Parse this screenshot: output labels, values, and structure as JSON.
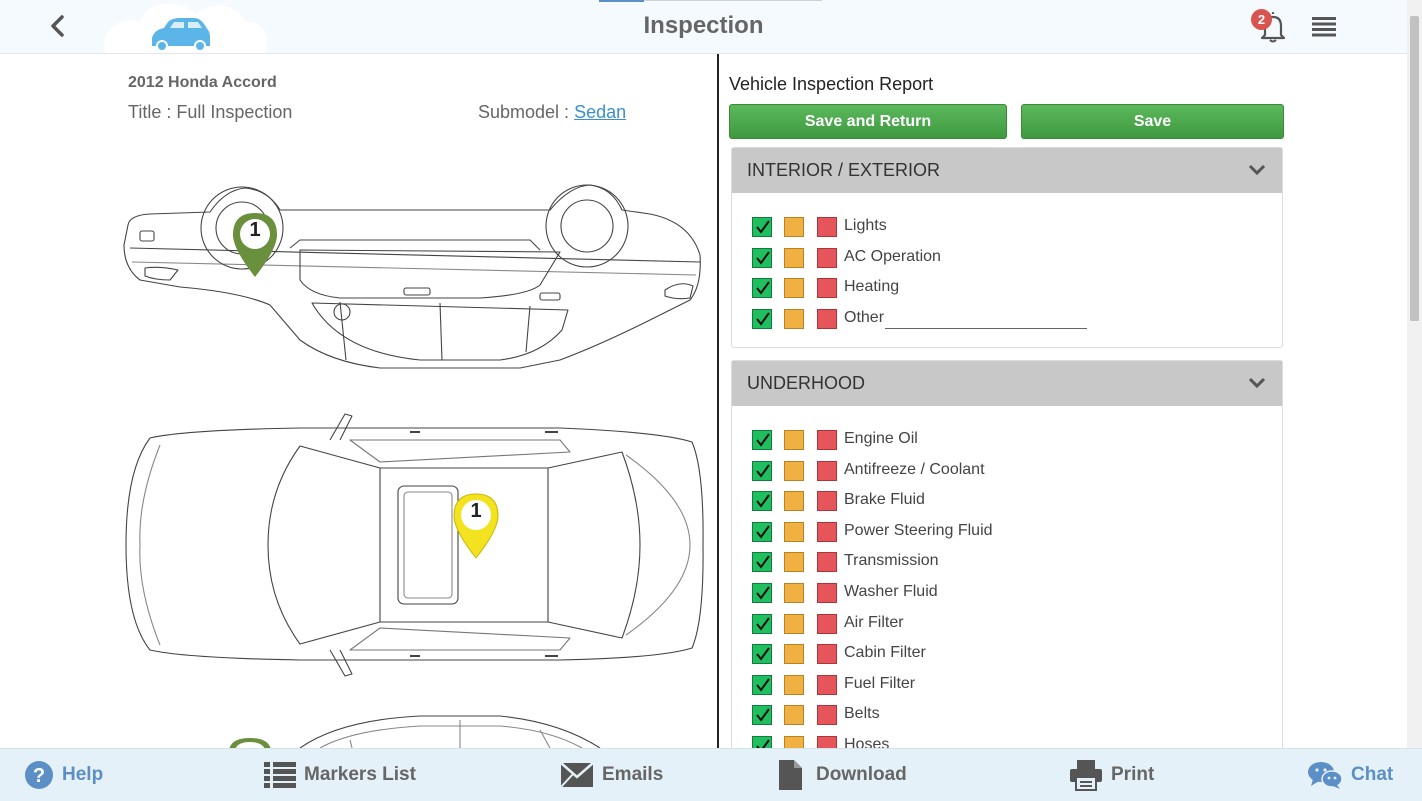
{
  "header": {
    "title": "Inspection",
    "notification_count": "2"
  },
  "vehicle": {
    "name": "2012 Honda Accord",
    "title_label": "Title : ",
    "title_value": "Full Inspection",
    "submodel_label": "Submodel : ",
    "submodel_value": "Sedan"
  },
  "markers": [
    {
      "number": "1",
      "color": "#6a8f3d"
    },
    {
      "number": "1",
      "color": "#f2e21f"
    }
  ],
  "report": {
    "title": "Vehicle Inspection Report",
    "save_return_label": "Save and Return",
    "save_label": "Save"
  },
  "sections": [
    {
      "title": "INTERIOR / EXTERIOR",
      "items": [
        "Lights",
        "AC Operation",
        "Heating",
        "Other"
      ]
    },
    {
      "title": "UNDERHOOD",
      "items": [
        "Engine Oil",
        "Antifreeze / Coolant",
        "Brake Fluid",
        "Power Steering Fluid",
        "Transmission",
        "Washer Fluid",
        "Air Filter",
        "Cabin Filter",
        "Fuel Filter",
        "Belts",
        "Hoses"
      ]
    }
  ],
  "status_colors": {
    "good": "#1fbf5f",
    "attention": "#f0b042",
    "urgent": "#e6555a"
  },
  "footer": {
    "help": "Help",
    "markers_list": "Markers List",
    "emails": "Emails",
    "download": "Download",
    "print": "Print",
    "chat": "Chat"
  }
}
